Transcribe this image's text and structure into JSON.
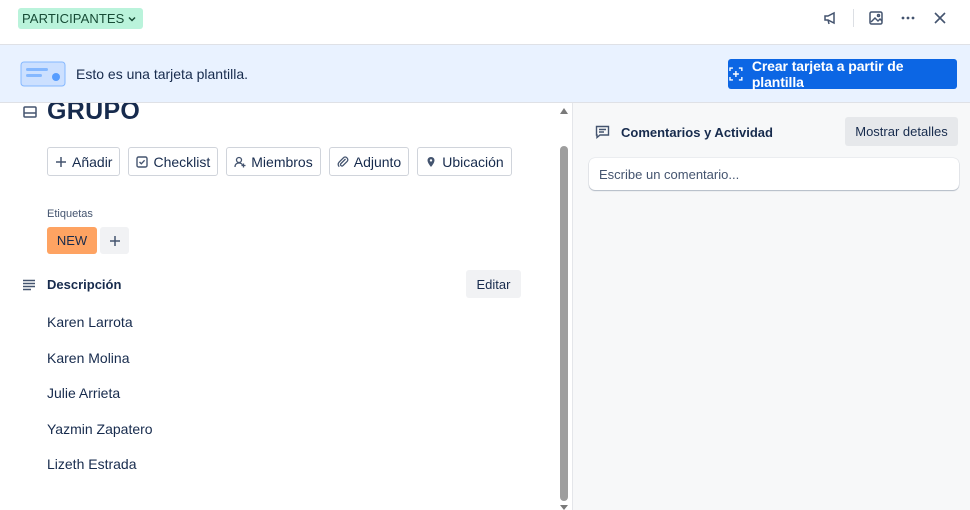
{
  "header": {
    "list_badge": "PARTICIPANTES",
    "icons": [
      "megaphone-icon",
      "image-icon",
      "more-icon",
      "close-icon"
    ]
  },
  "banner": {
    "text": "Esto es una tarjeta plantilla.",
    "create_button": "Crear tarjeta a partir de plantilla",
    "background": "#e9f2ff",
    "button_color": "#0c66e4"
  },
  "card": {
    "title": "GRUPO",
    "actions": [
      {
        "label": "Añadir",
        "icon": "plus-icon"
      },
      {
        "label": "Checklist",
        "icon": "checklist-icon"
      },
      {
        "label": "Miembros",
        "icon": "members-icon"
      },
      {
        "label": "Adjunto",
        "icon": "paperclip-icon"
      },
      {
        "label": "Ubicación",
        "icon": "location-pin-icon"
      }
    ],
    "labels_title": "Etiquetas",
    "labels": [
      {
        "text": "NEW",
        "color": "#fea362"
      }
    ],
    "description": {
      "title": "Descripción",
      "edit_button": "Editar",
      "items": [
        "Karen Larrota",
        "Karen Molina",
        "Julie Arrieta",
        "Yazmin Zapatero",
        "Lizeth Estrada"
      ]
    }
  },
  "sidebar": {
    "title": "Comentarios y Actividad",
    "details_button": "Mostrar detalles",
    "comment_placeholder": "Escribe un comentario..."
  }
}
